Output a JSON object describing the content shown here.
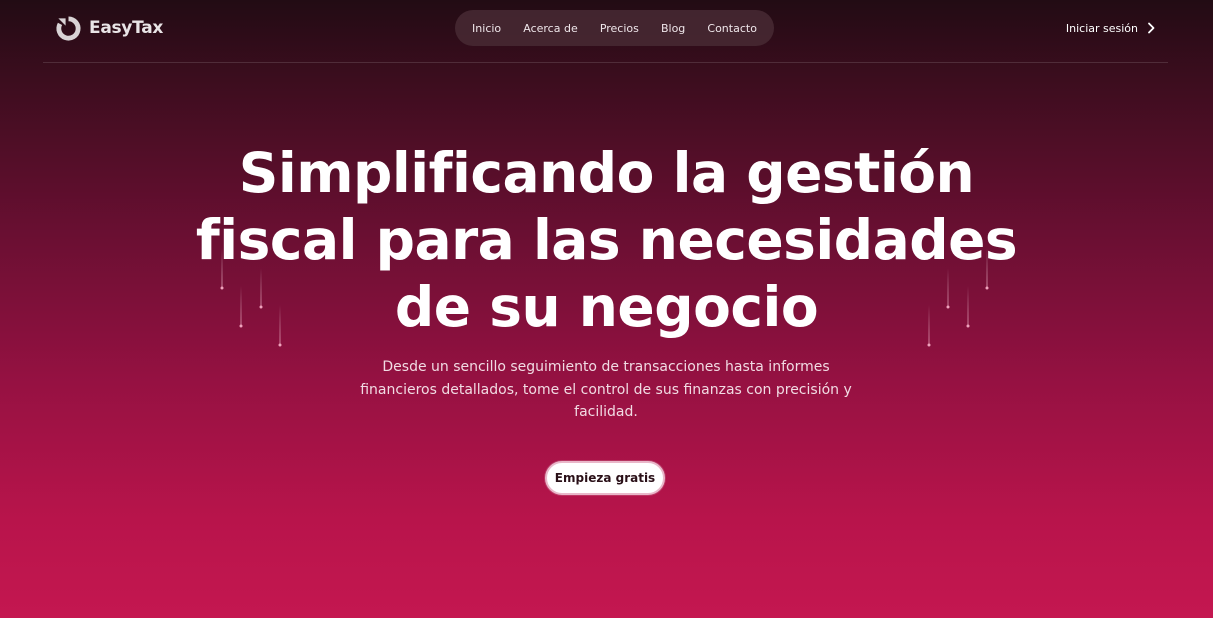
{
  "brand": {
    "name": "EasyTax",
    "logo_icon": "easytax-logo-icon"
  },
  "nav": {
    "items": [
      {
        "label": "Inicio"
      },
      {
        "label": "Acerca de"
      },
      {
        "label": "Precios"
      },
      {
        "label": "Blog"
      },
      {
        "label": "Contacto"
      }
    ]
  },
  "header": {
    "login_label": "Iniciar sesión",
    "login_icon": "chevron-right-icon"
  },
  "hero": {
    "title_lines": [
      "Simplificando la gestión",
      "fiscal para las necesidades",
      "de su negocio"
    ],
    "subtitle_lines": [
      "Desde un sencillo seguimiento de transacciones hasta informes",
      "financieros detallados, tome el control de sus finanzas con precisión y",
      "facilidad."
    ],
    "cta_label": "Empieza gratis"
  },
  "colors": {
    "background_top": "#220c14",
    "background_bottom": "#c41750",
    "nav_pill": "#482a34",
    "cta_background": "#ffffff",
    "cta_text": "#2a1018"
  }
}
